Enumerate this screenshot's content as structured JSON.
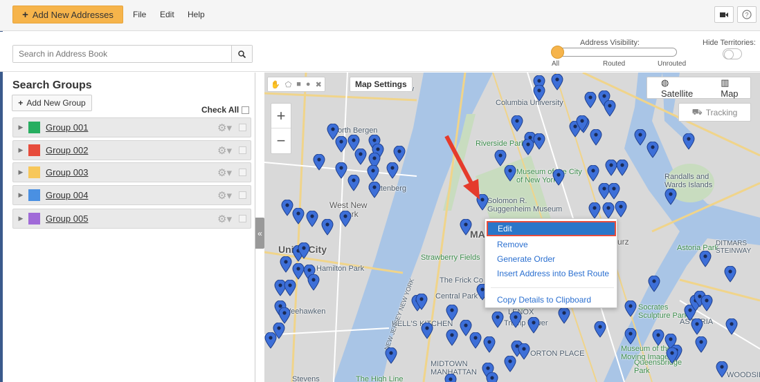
{
  "toolbar": {
    "add_label": "Add New Addresses",
    "add_icon": "plus-icon",
    "menu": [
      "File",
      "Edit",
      "Help"
    ],
    "camera_icon": "video-camera-icon",
    "help_icon": "question-icon"
  },
  "search": {
    "placeholder": "Search in Address Book",
    "icon": "search-icon"
  },
  "visibility": {
    "title": "Address Visibility:",
    "options": [
      "All",
      "Routed",
      "Unrouted"
    ],
    "selected": "All"
  },
  "hide_territories": {
    "title": "Hide Territories:",
    "on": false
  },
  "sidebar": {
    "title": "Search Groups",
    "new_group_label": "Add New Group",
    "check_all_label": "Check All",
    "groups": [
      {
        "name": "Group 001",
        "color": "#27ae60"
      },
      {
        "name": "Group 002",
        "color": "#e74c3c"
      },
      {
        "name": "Group 003",
        "color": "#f7c75a"
      },
      {
        "name": "Group 004",
        "color": "#4a90e2"
      },
      {
        "name": "Group 005",
        "color": "#a06ad8"
      }
    ]
  },
  "map": {
    "settings_label": "Map Settings",
    "satellite_label": "Satellite",
    "map_label": "Map",
    "tracking_label": "Tracking",
    "zoom_in": "+",
    "zoom_out": "−",
    "labels": [
      "North Bergen",
      "West New",
      "York",
      "Guttenberg",
      "Union City",
      "Hamilton Park",
      "Weehawken",
      "Columbia University",
      "Riverside Park",
      "Museum of the City of New York",
      "Solomon R. Guggenheim Museum",
      "Randalls and Wards Islands",
      "Strawberry Fields",
      "The Frick Co",
      "Central Park Z",
      "Astoria Park",
      "DITMARS STEINWAY",
      "Socrates Sculpture Park",
      "ASTORIA",
      "Trump Tower",
      "LENOX",
      "HELL'S KITCHEN",
      "MIDTOWN MANHATTAN",
      "Queensbridge Park",
      "Museum of the Moving Image",
      "The High Line",
      "Stevens",
      "NEW JERSEY NEW YORK",
      "ORTON PLACE",
      "WOODSID",
      "ew",
      "MA",
      "urz"
    ]
  },
  "context_menu": {
    "items": [
      "Edit",
      "Remove",
      "Generate Order",
      "Insert Address into Best Route",
      "Copy Details to Clipboard"
    ],
    "highlighted": "Edit"
  }
}
